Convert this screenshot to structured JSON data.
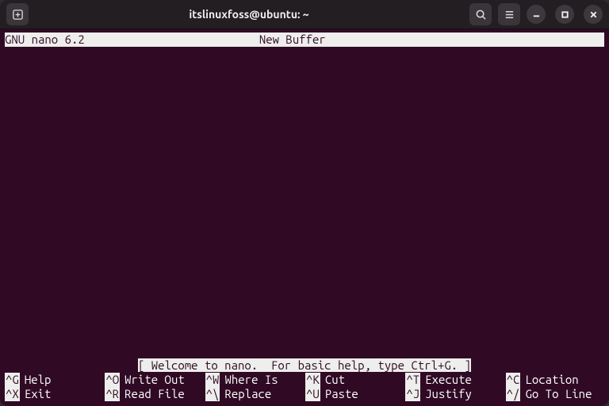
{
  "window": {
    "title": "itslinuxfoss@ubuntu: ~"
  },
  "status": {
    "app": "GNU nano 6.2",
    "buffer": "New Buffer"
  },
  "message": "[ Welcome to nano.  For basic help, type Ctrl+G. ]",
  "shortcuts": {
    "row1": [
      {
        "key": "^G",
        "label": "Help"
      },
      {
        "key": "^O",
        "label": "Write Out"
      },
      {
        "key": "^W",
        "label": "Where Is"
      },
      {
        "key": "^K",
        "label": "Cut"
      },
      {
        "key": "^T",
        "label": "Execute"
      },
      {
        "key": "^C",
        "label": "Location"
      }
    ],
    "row2": [
      {
        "key": "^X",
        "label": "Exit"
      },
      {
        "key": "^R",
        "label": "Read File"
      },
      {
        "key": "^\\",
        "label": "Replace"
      },
      {
        "key": "^U",
        "label": "Paste"
      },
      {
        "key": "^J",
        "label": "Justify"
      },
      {
        "key": "^/",
        "label": "Go To Line"
      }
    ]
  }
}
